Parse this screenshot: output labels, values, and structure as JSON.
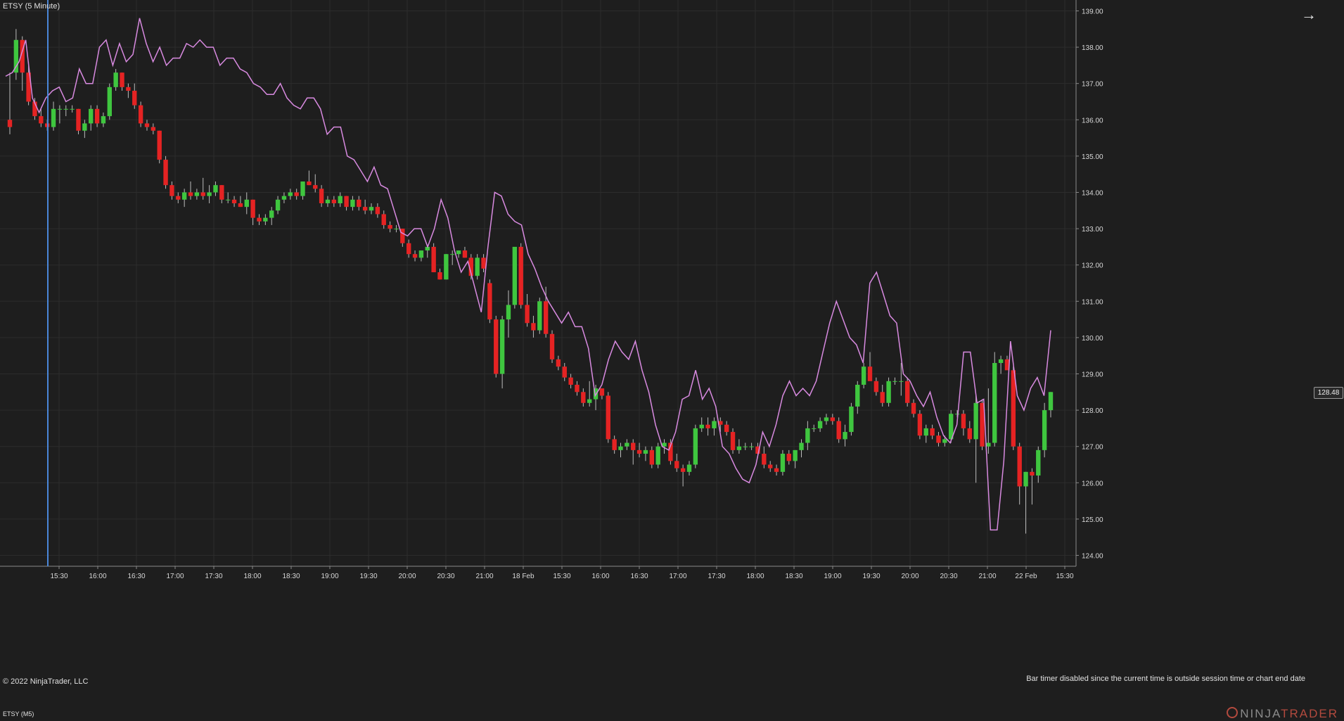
{
  "header": {
    "title": "ETSY (5 Minute)"
  },
  "footer": {
    "copyright": "© 2022 NinjaTrader, LLC",
    "bar_timer": "Bar timer disabled since the current time is outside session time or chart end date",
    "panel_label": "ETSY (M5)",
    "logo": {
      "part1": "NINJA",
      "part2": "TRADER"
    }
  },
  "toolbar": {
    "arrow_icon": "arrow-right-icon"
  },
  "colors": {
    "background": "#1e1e1e",
    "grid": "#2c2c2c",
    "up_candle": "#3fc63f",
    "down_candle": "#e52323",
    "wick": "#bcbcbc",
    "overlay_line": "#d88ae0",
    "cursor_line": "#4a86d8"
  },
  "chart_data": {
    "type": "candlestick",
    "title": "ETSY (5 Minute)",
    "xlabel": "",
    "ylabel": "",
    "ylim": [
      123.7,
      139.3
    ],
    "y_ticks": [
      "124.00",
      "125.00",
      "126.00",
      "127.00",
      "128.00",
      "129.00",
      "130.00",
      "131.00",
      "132.00",
      "133.00",
      "134.00",
      "135.00",
      "136.00",
      "137.00",
      "138.00",
      "139.00"
    ],
    "x_tick_labels": [
      "15:30",
      "16:00",
      "16:30",
      "17:00",
      "17:30",
      "18:00",
      "18:30",
      "19:00",
      "19:30",
      "20:00",
      "20:30",
      "21:00",
      "18 Feb",
      "15:30",
      "16:00",
      "16:30",
      "17:00",
      "17:30",
      "18:00",
      "18:30",
      "19:00",
      "19:30",
      "20:00",
      "20:30",
      "21:00",
      "22 Feb",
      "15:30"
    ],
    "last_price": "128.48",
    "candles": [
      [
        136.0,
        137.3,
        135.6,
        135.8
      ],
      [
        137.3,
        138.5,
        137.1,
        138.2
      ],
      [
        138.2,
        138.3,
        136.8,
        137.3
      ],
      [
        137.3,
        137.6,
        136.4,
        136.5
      ],
      [
        136.5,
        136.6,
        136.0,
        136.1
      ],
      [
        136.1,
        136.3,
        135.8,
        135.9
      ],
      [
        135.9,
        136.0,
        135.7,
        135.8
      ],
      [
        135.8,
        136.5,
        135.7,
        136.3
      ],
      [
        136.3,
        136.4,
        135.9,
        136.3
      ],
      [
        136.3,
        136.4,
        136.1,
        136.3
      ],
      [
        136.3,
        136.4,
        136.2,
        136.3
      ],
      [
        136.3,
        136.3,
        135.6,
        135.7
      ],
      [
        135.7,
        136.0,
        135.5,
        135.9
      ],
      [
        135.9,
        136.4,
        135.7,
        136.3
      ],
      [
        136.3,
        136.4,
        135.8,
        135.9
      ],
      [
        135.9,
        136.2,
        135.8,
        136.1
      ],
      [
        136.1,
        137.0,
        136.0,
        136.9
      ],
      [
        136.9,
        137.4,
        136.8,
        137.3
      ],
      [
        137.3,
        137.3,
        136.8,
        136.9
      ],
      [
        136.9,
        137.0,
        136.6,
        136.8
      ],
      [
        136.8,
        137.0,
        136.3,
        136.4
      ],
      [
        136.4,
        136.5,
        135.8,
        135.9
      ],
      [
        135.9,
        136.0,
        135.7,
        135.8
      ],
      [
        135.8,
        135.9,
        135.6,
        135.7
      ],
      [
        135.7,
        135.7,
        134.8,
        134.9
      ],
      [
        134.9,
        135.0,
        134.1,
        134.2
      ],
      [
        134.2,
        134.3,
        133.8,
        133.9
      ],
      [
        133.9,
        134.0,
        133.7,
        133.8
      ],
      [
        133.8,
        134.1,
        133.6,
        134.0
      ],
      [
        134.0,
        134.3,
        133.8,
        133.9
      ],
      [
        133.9,
        134.1,
        133.8,
        134.0
      ],
      [
        134.0,
        134.4,
        133.8,
        133.9
      ],
      [
        133.9,
        134.2,
        133.7,
        134.0
      ],
      [
        134.0,
        134.3,
        133.9,
        134.2
      ],
      [
        134.2,
        134.2,
        133.7,
        133.8
      ],
      [
        133.8,
        134.0,
        133.7,
        133.8
      ],
      [
        133.8,
        133.9,
        133.6,
        133.7
      ],
      [
        133.7,
        133.9,
        133.6,
        133.6
      ],
      [
        133.6,
        134.0,
        133.4,
        133.8
      ],
      [
        133.8,
        133.8,
        133.1,
        133.3
      ],
      [
        133.3,
        133.4,
        133.1,
        133.2
      ],
      [
        133.2,
        133.4,
        133.1,
        133.3
      ],
      [
        133.3,
        133.6,
        133.1,
        133.5
      ],
      [
        133.5,
        133.9,
        133.4,
        133.8
      ],
      [
        133.8,
        134.0,
        133.7,
        133.9
      ],
      [
        133.9,
        134.1,
        133.8,
        134.0
      ],
      [
        134.0,
        134.1,
        133.8,
        133.9
      ],
      [
        133.9,
        134.3,
        133.8,
        134.3
      ],
      [
        134.3,
        134.6,
        134.2,
        134.2
      ],
      [
        134.2,
        134.5,
        134.0,
        134.1
      ],
      [
        134.1,
        134.2,
        133.6,
        133.7
      ],
      [
        133.7,
        133.9,
        133.6,
        133.8
      ],
      [
        133.8,
        133.9,
        133.6,
        133.7
      ],
      [
        133.7,
        134.0,
        133.6,
        133.9
      ],
      [
        133.9,
        133.9,
        133.5,
        133.6
      ],
      [
        133.6,
        133.9,
        133.5,
        133.8
      ],
      [
        133.8,
        133.9,
        133.5,
        133.6
      ],
      [
        133.6,
        133.8,
        133.4,
        133.5
      ],
      [
        133.5,
        133.7,
        133.4,
        133.6
      ],
      [
        133.6,
        133.7,
        133.3,
        133.4
      ],
      [
        133.4,
        133.5,
        133.0,
        133.1
      ],
      [
        133.1,
        133.2,
        132.9,
        133.0
      ],
      [
        133.0,
        133.1,
        132.9,
        133.0
      ],
      [
        133.0,
        133.0,
        132.5,
        132.6
      ],
      [
        132.6,
        132.7,
        132.2,
        132.3
      ],
      [
        132.3,
        132.4,
        132.1,
        132.2
      ],
      [
        132.2,
        132.4,
        132.1,
        132.4
      ],
      [
        132.4,
        132.5,
        132.2,
        132.5
      ],
      [
        132.5,
        132.6,
        131.8,
        131.8
      ],
      [
        131.8,
        131.9,
        131.6,
        131.6
      ],
      [
        131.6,
        132.3,
        131.6,
        132.3
      ],
      [
        132.3,
        132.4,
        132.0,
        132.3
      ],
      [
        132.3,
        132.4,
        132.2,
        132.4
      ],
      [
        132.4,
        132.5,
        132.2,
        132.2
      ],
      [
        132.2,
        132.3,
        131.6,
        131.7
      ],
      [
        131.7,
        132.3,
        131.6,
        132.2
      ],
      [
        132.2,
        132.3,
        131.8,
        131.9
      ],
      [
        131.5,
        131.6,
        130.4,
        130.5
      ],
      [
        130.5,
        130.6,
        128.9,
        129.0
      ],
      [
        129.0,
        130.6,
        128.6,
        130.5
      ],
      [
        130.5,
        131.3,
        130.0,
        130.9
      ],
      [
        130.9,
        132.4,
        130.8,
        132.5
      ],
      [
        132.5,
        132.6,
        130.8,
        130.9
      ],
      [
        130.9,
        131.2,
        130.3,
        130.4
      ],
      [
        130.4,
        130.6,
        130.0,
        130.2
      ],
      [
        130.2,
        131.1,
        130.1,
        131.0
      ],
      [
        131.0,
        131.4,
        130.0,
        130.1
      ],
      [
        130.1,
        130.2,
        129.3,
        129.4
      ],
      [
        129.4,
        129.5,
        129.1,
        129.2
      ],
      [
        129.2,
        129.3,
        128.8,
        128.9
      ],
      [
        128.9,
        129.0,
        128.6,
        128.7
      ],
      [
        128.7,
        128.8,
        128.4,
        128.5
      ],
      [
        128.5,
        128.6,
        128.1,
        128.2
      ],
      [
        128.2,
        128.8,
        128.1,
        128.3
      ],
      [
        128.3,
        128.7,
        128.0,
        128.6
      ],
      [
        128.6,
        128.6,
        128.3,
        128.4
      ],
      [
        128.4,
        128.5,
        127.1,
        127.2
      ],
      [
        127.2,
        127.3,
        126.8,
        126.9
      ],
      [
        126.9,
        127.1,
        126.7,
        127.0
      ],
      [
        127.0,
        127.2,
        126.9,
        127.1
      ],
      [
        127.1,
        127.2,
        126.5,
        126.9
      ],
      [
        126.9,
        127.1,
        126.7,
        126.8
      ],
      [
        126.8,
        127.0,
        126.6,
        126.9
      ],
      [
        126.9,
        127.0,
        126.4,
        126.5
      ],
      [
        126.5,
        127.1,
        126.4,
        127.0
      ],
      [
        127.0,
        127.2,
        126.8,
        127.1
      ],
      [
        127.1,
        127.2,
        126.5,
        126.6
      ],
      [
        126.6,
        126.8,
        126.3,
        126.4
      ],
      [
        126.4,
        126.5,
        125.9,
        126.3
      ],
      [
        126.3,
        126.6,
        126.2,
        126.5
      ],
      [
        126.5,
        127.6,
        126.4,
        127.5
      ],
      [
        127.5,
        127.8,
        127.4,
        127.6
      ],
      [
        127.6,
        127.8,
        127.3,
        127.5
      ],
      [
        127.5,
        127.8,
        127.3,
        127.7
      ],
      [
        127.7,
        127.8,
        127.4,
        127.6
      ],
      [
        127.6,
        127.7,
        127.3,
        127.4
      ],
      [
        127.4,
        127.5,
        126.8,
        126.9
      ],
      [
        126.9,
        127.2,
        126.8,
        127.0
      ],
      [
        127.0,
        127.1,
        126.9,
        127.0
      ],
      [
        127.0,
        127.1,
        126.9,
        127.0
      ],
      [
        127.0,
        127.1,
        126.7,
        126.8
      ],
      [
        126.8,
        127.0,
        126.4,
        126.5
      ],
      [
        126.5,
        126.6,
        126.3,
        126.4
      ],
      [
        126.4,
        126.5,
        126.2,
        126.3
      ],
      [
        126.3,
        126.9,
        126.2,
        126.8
      ],
      [
        126.8,
        126.9,
        126.5,
        126.6
      ],
      [
        126.6,
        126.9,
        126.4,
        126.9
      ],
      [
        126.9,
        127.2,
        126.7,
        127.1
      ],
      [
        127.1,
        127.7,
        126.9,
        127.5
      ],
      [
        127.5,
        127.6,
        127.4,
        127.5
      ],
      [
        127.5,
        127.8,
        127.4,
        127.7
      ],
      [
        127.7,
        127.9,
        127.6,
        127.8
      ],
      [
        127.8,
        127.9,
        127.6,
        127.7
      ],
      [
        127.7,
        127.8,
        127.1,
        127.2
      ],
      [
        127.2,
        127.6,
        127.0,
        127.4
      ],
      [
        127.4,
        128.2,
        127.3,
        128.1
      ],
      [
        128.1,
        128.8,
        127.9,
        128.7
      ],
      [
        128.7,
        129.3,
        128.6,
        129.2
      ],
      [
        129.2,
        129.6,
        129.0,
        128.8
      ],
      [
        128.8,
        128.9,
        128.4,
        128.5
      ],
      [
        128.5,
        128.7,
        128.1,
        128.2
      ],
      [
        128.2,
        128.9,
        128.1,
        128.8
      ],
      [
        128.8,
        128.9,
        128.7,
        128.8
      ],
      [
        128.8,
        129.3,
        128.4,
        128.8
      ],
      [
        128.8,
        128.9,
        128.1,
        128.2
      ],
      [
        128.2,
        128.3,
        127.8,
        127.9
      ],
      [
        127.9,
        128.0,
        127.2,
        127.3
      ],
      [
        127.3,
        127.6,
        127.1,
        127.5
      ],
      [
        127.5,
        127.6,
        127.2,
        127.3
      ],
      [
        127.3,
        127.4,
        127.0,
        127.1
      ],
      [
        127.1,
        127.3,
        127.0,
        127.2
      ],
      [
        127.2,
        128.0,
        127.1,
        127.9
      ],
      [
        127.9,
        128.0,
        127.8,
        127.9
      ],
      [
        127.9,
        128.0,
        127.3,
        127.5
      ],
      [
        127.5,
        127.7,
        127.1,
        127.2
      ],
      [
        127.2,
        128.4,
        126.0,
        128.2
      ],
      [
        128.2,
        128.3,
        126.9,
        127.0
      ],
      [
        127.0,
        128.6,
        126.8,
        127.1
      ],
      [
        127.1,
        129.6,
        127.0,
        129.3
      ],
      [
        129.3,
        129.5,
        129.0,
        129.4
      ],
      [
        129.4,
        129.5,
        129.2,
        129.1
      ],
      [
        129.1,
        129.2,
        126.9,
        127.0
      ],
      [
        127.0,
        127.1,
        125.4,
        125.9
      ],
      [
        125.9,
        126.3,
        124.6,
        126.3
      ],
      [
        126.3,
        126.4,
        125.4,
        126.2
      ],
      [
        126.2,
        127.0,
        126.0,
        126.9
      ],
      [
        126.9,
        128.2,
        126.7,
        128.0
      ],
      [
        128.0,
        128.5,
        127.8,
        128.5
      ]
    ],
    "overlay_series": {
      "values": [
        137.2,
        137.3,
        137.6,
        138.2,
        136.6,
        136.2,
        136.6,
        136.8,
        136.9,
        136.5,
        136.6,
        137.4,
        137.0,
        137.0,
        138.0,
        138.2,
        137.5,
        138.1,
        137.6,
        137.8,
        138.8,
        138.1,
        137.6,
        138.0,
        137.5,
        137.7,
        137.7,
        138.1,
        138.0,
        138.2,
        138.0,
        138.0,
        137.5,
        137.7,
        137.7,
        137.4,
        137.3,
        137.0,
        136.9,
        136.7,
        136.7,
        137.0,
        136.6,
        136.4,
        136.3,
        136.6,
        136.6,
        136.3,
        135.6,
        135.8,
        135.8,
        135.0,
        134.9,
        134.6,
        134.3,
        134.7,
        134.2,
        134.1,
        133.5,
        132.9,
        132.8,
        133.0,
        133.0,
        132.5,
        133.0,
        133.8,
        133.3,
        132.4,
        131.8,
        132.1,
        131.4,
        130.7,
        132.5,
        134.0,
        133.9,
        133.4,
        133.2,
        133.1,
        132.3,
        131.9,
        131.4,
        131.0,
        130.7,
        130.4,
        130.7,
        130.3,
        130.3,
        129.7,
        128.4,
        128.7,
        129.4,
        129.9,
        129.6,
        129.4,
        129.9,
        129.1,
        128.5,
        127.6,
        127.0,
        126.9,
        127.4,
        128.3,
        128.4,
        129.1,
        128.3,
        128.6,
        128.1,
        127.0,
        126.8,
        126.4,
        126.1,
        126.0,
        126.5,
        127.4,
        127.0,
        127.6,
        128.4,
        128.8,
        128.4,
        128.6,
        128.4,
        128.8,
        129.6,
        130.4,
        131.0,
        130.5,
        130.0,
        129.8,
        129.3,
        131.5,
        131.8,
        131.2,
        130.6,
        130.4,
        129.0,
        128.8,
        128.4,
        128.1,
        128.5,
        127.8,
        127.3,
        127.1,
        127.6,
        129.6,
        129.6,
        128.2,
        128.3,
        124.7,
        124.7,
        126.6,
        129.9,
        128.4,
        128.0,
        128.6,
        128.9,
        128.4,
        130.2
      ]
    }
  }
}
